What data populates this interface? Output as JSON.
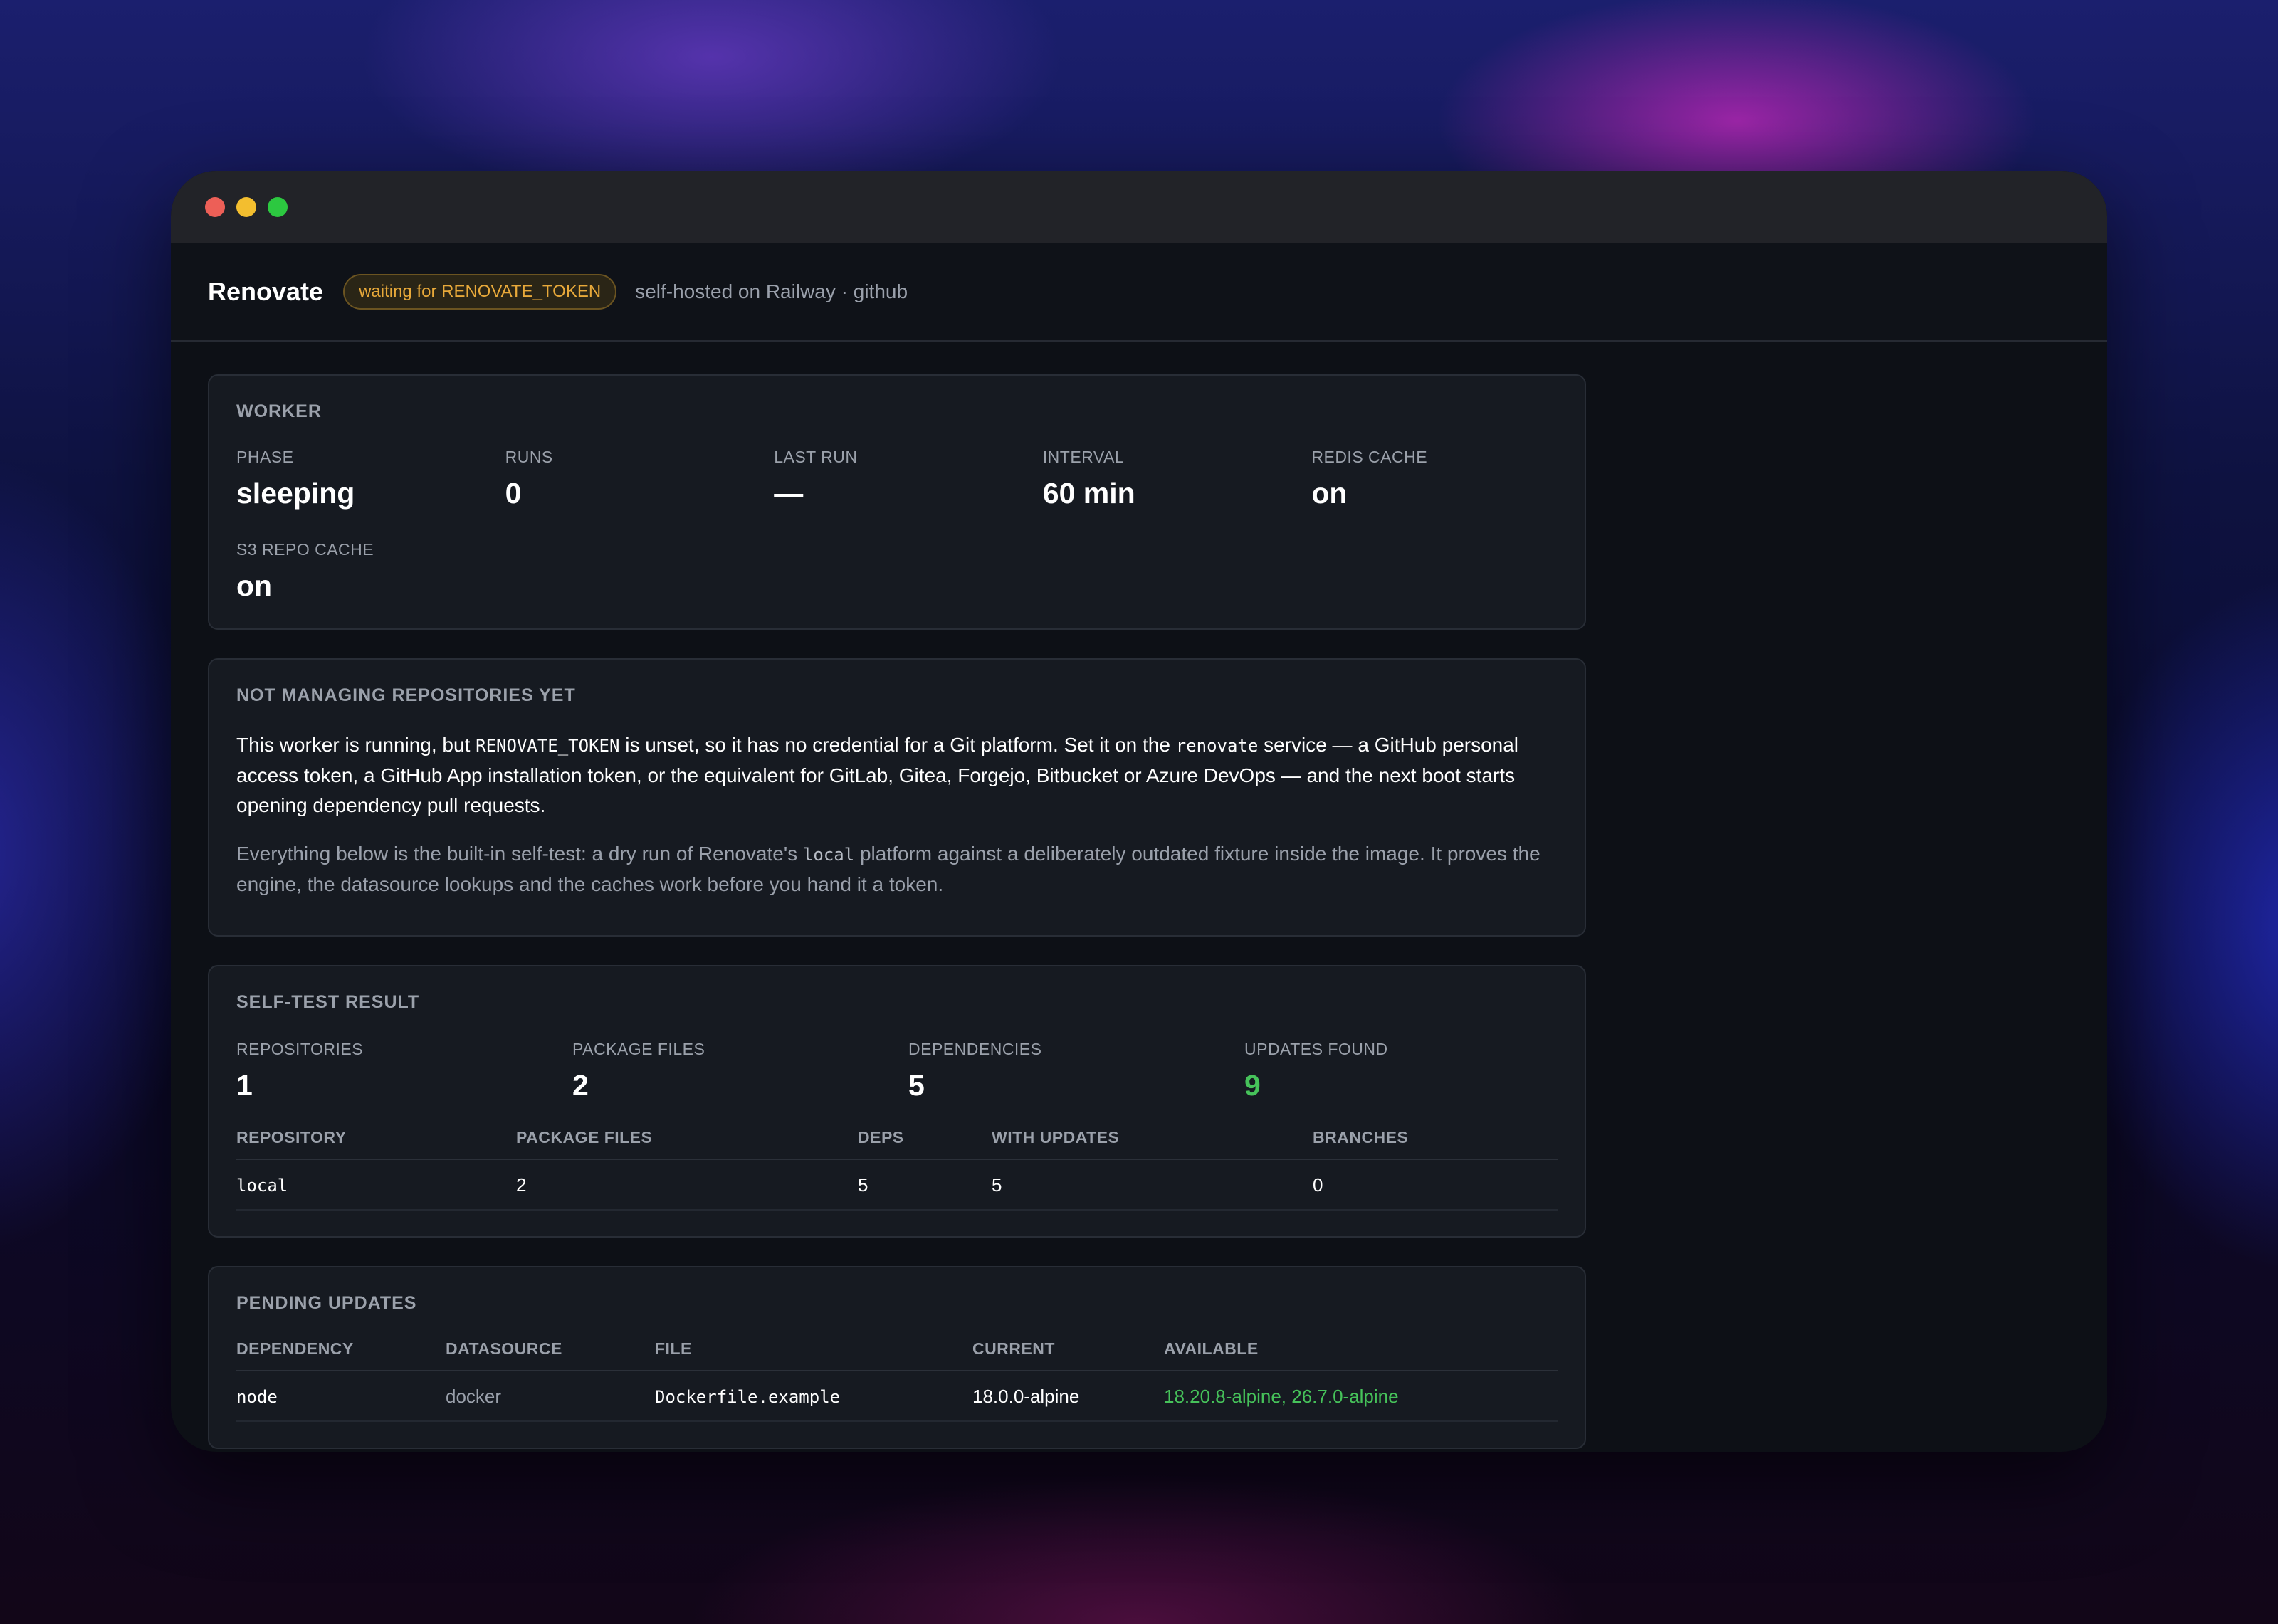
{
  "app": {
    "title": "Renovate",
    "status_badge": "waiting for RENOVATE_TOKEN",
    "subtitle": "self-hosted on Railway · github"
  },
  "worker": {
    "title": "WORKER",
    "stats": [
      {
        "label": "PHASE",
        "value": "sleeping"
      },
      {
        "label": "RUNS",
        "value": "0"
      },
      {
        "label": "LAST RUN",
        "value": "—"
      },
      {
        "label": "INTERVAL",
        "value": "60 min"
      },
      {
        "label": "REDIS CACHE",
        "value": "on"
      },
      {
        "label": "S3 REPO CACHE",
        "value": "on"
      }
    ]
  },
  "notice": {
    "title": "NOT MANAGING REPOSITORIES YET",
    "p1": {
      "a": "This worker is running, but ",
      "code1": "RENOVATE_TOKEN",
      "b": " is unset, so it has no credential for a Git platform. Set it on the ",
      "code2": "renovate",
      "c": " service — a GitHub personal access token, a GitHub App installation token, or the equivalent for GitLab, Gitea, Forgejo, Bitbucket or Azure DevOps — and the next boot starts opening dependency pull requests."
    },
    "p2": {
      "a": "Everything below is the built-in self-test: a dry run of Renovate's ",
      "code1": "local",
      "b": " platform against a deliberately outdated fixture inside the image. It proves the engine, the datasource lookups and the caches work before you hand it a token."
    }
  },
  "selftest": {
    "title": "SELF-TEST RESULT",
    "stats": [
      {
        "label": "REPOSITORIES",
        "value": "1"
      },
      {
        "label": "PACKAGE FILES",
        "value": "2"
      },
      {
        "label": "DEPENDENCIES",
        "value": "5"
      },
      {
        "label": "UPDATES FOUND",
        "value": "9"
      }
    ],
    "columns": [
      "REPOSITORY",
      "PACKAGE FILES",
      "DEPS",
      "WITH UPDATES",
      "BRANCHES"
    ],
    "rows": [
      [
        "local",
        "2",
        "5",
        "5",
        "0"
      ]
    ]
  },
  "pending": {
    "title": "PENDING UPDATES",
    "columns": [
      "DEPENDENCY",
      "DATASOURCE",
      "FILE",
      "CURRENT",
      "AVAILABLE"
    ],
    "rows": [
      [
        "node",
        "docker",
        "Dockerfile.example",
        "18.0.0-alpine",
        "18.20.8-alpine, 26.7.0-alpine"
      ]
    ]
  },
  "colors": {
    "accent_green": "#46c25a",
    "badge_amber": "#e8a93a"
  }
}
